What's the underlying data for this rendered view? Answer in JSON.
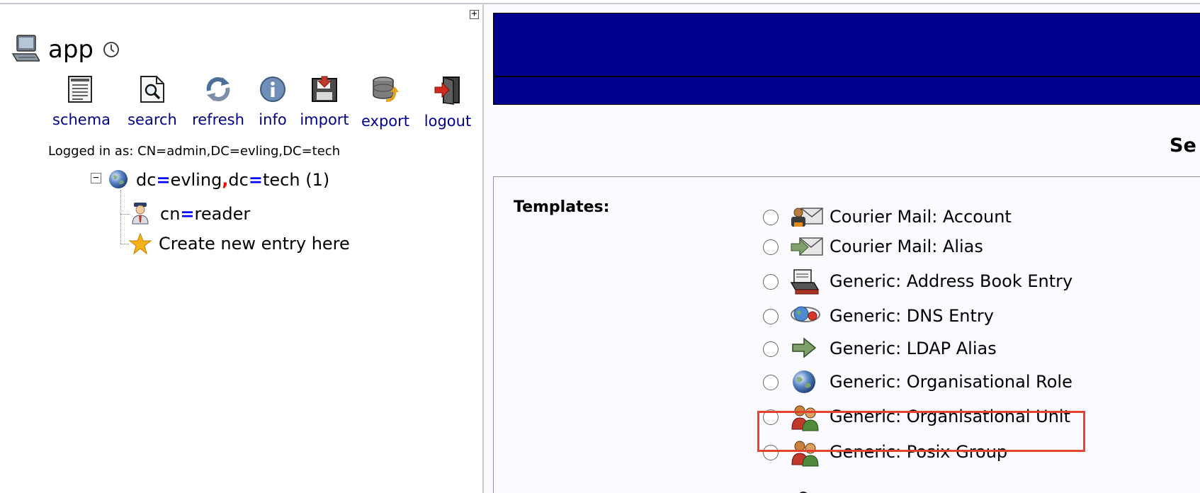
{
  "server": {
    "name": "app",
    "logged_in_text": "Logged in as: CN=admin,DC=evling,DC=tech"
  },
  "toolbar": [
    {
      "key": "schema",
      "label": "schema",
      "icon": "schema-document-icon"
    },
    {
      "key": "search",
      "label": "search",
      "icon": "search-magnifier-icon"
    },
    {
      "key": "refresh",
      "label": "refresh",
      "icon": "refresh-arrows-icon"
    },
    {
      "key": "info",
      "label": "info",
      "icon": "info-icon"
    },
    {
      "key": "import",
      "label": "import",
      "icon": "import-floppy-icon"
    },
    {
      "key": "export",
      "label": "export",
      "icon": "export-database-icon"
    },
    {
      "key": "logout",
      "label": "logout",
      "icon": "logout-door-icon"
    }
  ],
  "tree": {
    "root": {
      "attr1": "dc",
      "val1": "evling",
      "attr2": "dc",
      "val2": "tech",
      "count": "(1)"
    },
    "children": [
      {
        "attr": "cn",
        "value": "reader"
      }
    ],
    "create_label": "Create new entry here"
  },
  "main": {
    "title": "Se",
    "templates_label": "Templates:",
    "templates": [
      {
        "label": "Courier Mail: Account",
        "icon": "mail-account-icon"
      },
      {
        "label": "Courier Mail: Alias",
        "icon": "mail-alias-icon"
      },
      {
        "label": "Generic: Address Book Entry",
        "icon": "address-book-icon"
      },
      {
        "label": "Generic: DNS Entry",
        "icon": "dns-globe-icon"
      },
      {
        "label": "Generic: LDAP Alias",
        "icon": "ldap-alias-arrow-icon"
      },
      {
        "label": "Generic: Organisational Role",
        "icon": "globe-icon"
      },
      {
        "label": "Generic: Organisational Unit",
        "icon": "people-group-icon"
      },
      {
        "label": "Generic: Posix Group",
        "icon": "people-group-icon"
      }
    ],
    "highlighted_template": "Generic: Organisational Unit"
  },
  "colors": {
    "header": "#000090",
    "link": "#00008b",
    "highlight": "#e8412d",
    "equals": "#0000ff",
    "comma": "#ff0000"
  }
}
